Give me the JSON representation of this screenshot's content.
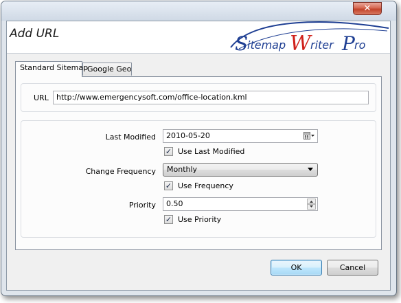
{
  "dialog": {
    "title": "Add URL",
    "logo_text": "Sitemap Writer Pro",
    "close_glyph": "✕"
  },
  "tabs": [
    {
      "label": "Standard Sitemap",
      "active": true
    },
    {
      "label": "Google Geo",
      "active": false
    }
  ],
  "url": {
    "label": "URL",
    "value": "http://www.emergencysoft.com/office-location.kml"
  },
  "last_modified": {
    "label": "Last Modified",
    "value": "2010-05-20",
    "icon": "calendar-dropdown-icon"
  },
  "use_last_modified": {
    "label": "Use Last Modified",
    "checked": true
  },
  "change_frequency": {
    "label": "Change Frequency",
    "value": "Monthly"
  },
  "use_frequency": {
    "label": "Use Frequency",
    "checked": true
  },
  "priority": {
    "label": "Priority",
    "value": "0.50"
  },
  "use_priority": {
    "label": "Use Priority",
    "checked": true
  },
  "buttons": {
    "ok": "OK",
    "cancel": "Cancel"
  },
  "colors": {
    "logo_blue": "#1f3f93",
    "logo_red": "#d0211b",
    "close_red": "#c2432a"
  }
}
